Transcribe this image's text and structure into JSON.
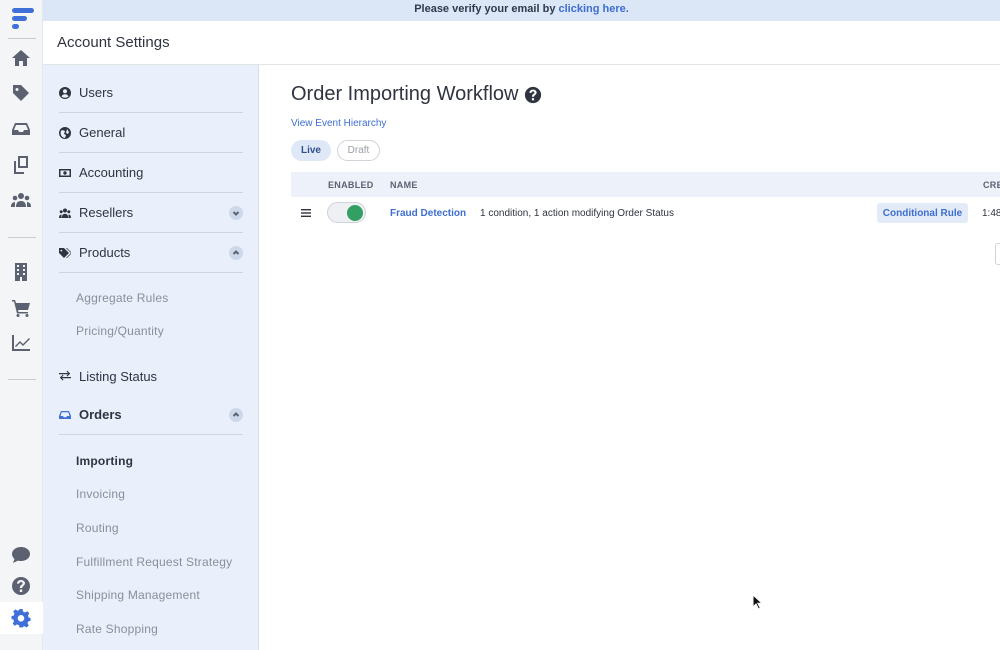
{
  "banner": {
    "text": "Please verify your email by ",
    "link": "clicking here."
  },
  "header": {
    "title": "Account Settings"
  },
  "rail": {
    "icons": [
      "logo-icon",
      "home-icon",
      "tag-icon",
      "inbox-icon",
      "copy-icon",
      "users-icon",
      "building-icon",
      "cart-icon",
      "chart-icon",
      "chat-icon",
      "help-icon",
      "gear-icon"
    ],
    "active": "gear-icon"
  },
  "nav": {
    "items": [
      {
        "label": "Users",
        "icon": "user-circle-icon"
      },
      {
        "label": "General",
        "icon": "globe-icon"
      },
      {
        "label": "Accounting",
        "icon": "money-icon"
      },
      {
        "label": "Resellers",
        "icon": "users-icon",
        "chevron": "down"
      },
      {
        "label": "Products",
        "icon": "tags-icon",
        "chevron": "up"
      },
      {
        "label": "Listing Status",
        "icon": "exchange-icon"
      },
      {
        "label": "Orders",
        "icon": "inbox-icon",
        "chevron": "up"
      }
    ],
    "products_sub": [
      "Aggregate Rules",
      "Pricing/Quantity"
    ],
    "orders_sub": [
      "Importing",
      "Invoicing",
      "Routing",
      "Fulfillment Request Strategy",
      "Shipping Management",
      "Rate Shopping"
    ],
    "active_sub": "Importing"
  },
  "main": {
    "title": "Order Importing Workflow",
    "hierarchy_link": "View Event Hierarchy",
    "tabs": {
      "live": "Live",
      "draft": "Draft",
      "selected": "Live"
    },
    "columns": {
      "enabled": "ENABLED",
      "name": "NAME",
      "created": "CRE"
    },
    "rows": [
      {
        "name": "Fraud Detection",
        "description": "1 condition, 1 action modifying Order Status",
        "type": "Conditional Rule",
        "time": "1:48",
        "enabled": true
      }
    ]
  },
  "colors": {
    "accent": "#3d6ed0",
    "toggle_on": "#33a063",
    "nav_bg": "#e9f0fb",
    "banner_bg": "#dbe6f7"
  }
}
